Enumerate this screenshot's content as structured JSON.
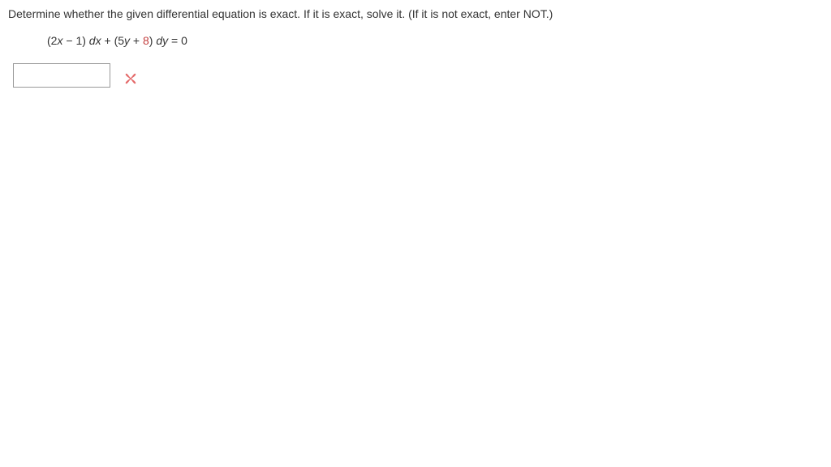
{
  "prompt": "Determine whether the given differential equation is exact. If it is exact, solve it. (If it is not exact, enter NOT.)",
  "equation": {
    "lparen1": "(",
    "coef1": "2",
    "var1": "x",
    "op1": " − ",
    "const1": "1",
    "rparen1": ")",
    "diff1": " dx",
    "plus": " + ",
    "lparen2": "(",
    "coef2": "5",
    "var2": "y",
    "op2": " + ",
    "const2": "8",
    "rparen2": ")",
    "diff2": " dy",
    "eq": " = ",
    "rhs": "0"
  },
  "answer_value": "",
  "feedback": "incorrect"
}
